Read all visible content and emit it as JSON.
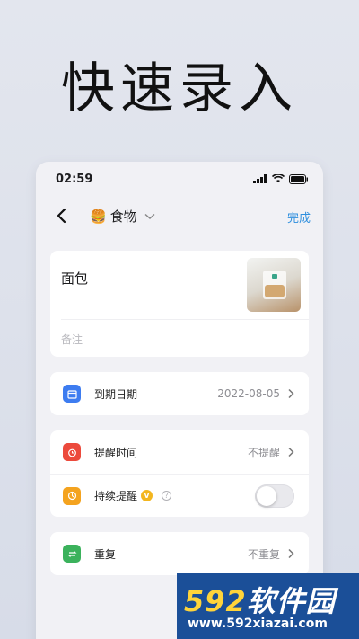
{
  "hero": {
    "title": "快速录入"
  },
  "status_bar": {
    "time": "02:59"
  },
  "nav": {
    "category_emoji": "🍔",
    "category_label": "食物",
    "done_label": "完成"
  },
  "item": {
    "name": "面包",
    "note_placeholder": "备注"
  },
  "expiry": {
    "label": "到期日期",
    "value": "2022-08-05",
    "color": "#3d7cf0"
  },
  "reminder": {
    "label": "提醒时间",
    "value": "不提醒",
    "color": "#ec4a3c"
  },
  "continuous": {
    "label": "持续提醒",
    "vip_badge": "V",
    "help": "?",
    "enabled": false,
    "color": "#f4a31f"
  },
  "repeat": {
    "label": "重复",
    "value": "不重复",
    "color": "#3bb25c"
  },
  "watermark": {
    "logo_prefix": "592",
    "logo_suffix": "软件园",
    "url": "www.592xiazai.com"
  }
}
